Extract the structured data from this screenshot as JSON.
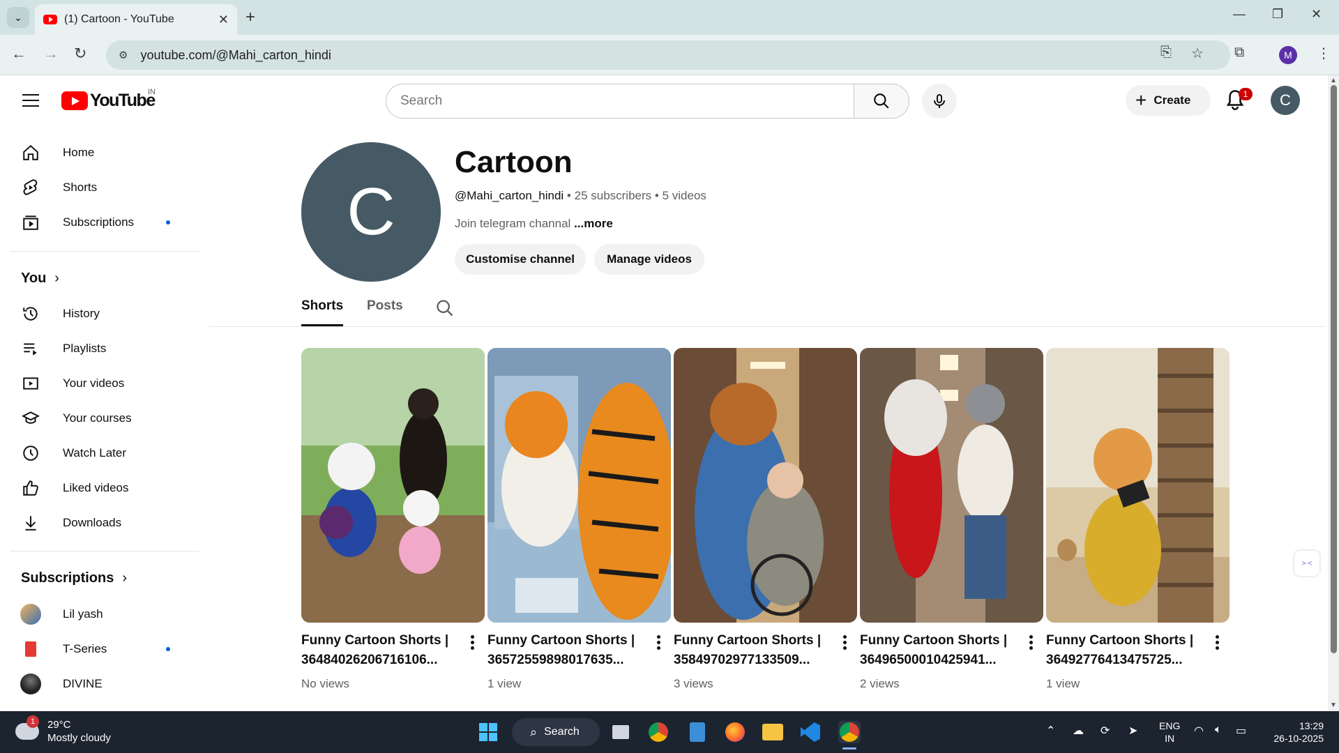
{
  "browser": {
    "tab_title": "(1) Cartoon - YouTube",
    "url": "youtube.com/@Mahi_carton_hindi",
    "profile_initial": "M"
  },
  "header": {
    "logo_text": "YouTube",
    "country": "IN",
    "search_placeholder": "Search",
    "create_label": "Create",
    "notification_count": "1",
    "avatar_initial": "C"
  },
  "sidebar": {
    "main": [
      {
        "label": "Home",
        "icon": "home-icon"
      },
      {
        "label": "Shorts",
        "icon": "shorts-icon"
      },
      {
        "label": "Subscriptions",
        "icon": "subscriptions-icon"
      }
    ],
    "you_title": "You",
    "you": [
      {
        "label": "History",
        "icon": "history-icon"
      },
      {
        "label": "Playlists",
        "icon": "playlists-icon"
      },
      {
        "label": "Your videos",
        "icon": "your-videos-icon"
      },
      {
        "label": "Your courses",
        "icon": "courses-icon"
      },
      {
        "label": "Watch Later",
        "icon": "clock-icon"
      },
      {
        "label": "Liked videos",
        "icon": "thumbs-up-icon"
      },
      {
        "label": "Downloads",
        "icon": "download-icon"
      }
    ],
    "subs_title": "Subscriptions",
    "subscriptions": [
      {
        "label": "Lil yash"
      },
      {
        "label": "T-Series"
      },
      {
        "label": "DIVINE"
      }
    ]
  },
  "channel": {
    "avatar_letter": "C",
    "name": "Cartoon",
    "handle": "@Mahi_carton_hindi",
    "subscribers": "25 subscribers",
    "videos": "5 videos",
    "separator": "•",
    "description": "Join telegram channal",
    "more": "...more",
    "customise_label": "Customise channel",
    "manage_label": "Manage videos",
    "tabs": [
      "Shorts",
      "Posts"
    ]
  },
  "shorts": [
    {
      "title1": "Funny Cartoon Shorts |",
      "title2": "36484026206716106...",
      "views": "No views"
    },
    {
      "title1": "Funny Cartoon Shorts |",
      "title2": "36572559898017635...",
      "views": "1 view"
    },
    {
      "title1": "Funny Cartoon Shorts |",
      "title2": "35849702977133509...",
      "views": "3 views"
    },
    {
      "title1": "Funny Cartoon Shorts |",
      "title2": "36496500010425941...",
      "views": "2 views"
    },
    {
      "title1": "Funny Cartoon Shorts |",
      "title2": "36492776413475725...",
      "views": "1 view"
    }
  ],
  "taskbar": {
    "weather_temp": "29°C",
    "weather_desc": "Mostly cloudy",
    "weather_badge": "1",
    "search_label": "Search",
    "lang_line1": "ENG",
    "lang_line2": "IN",
    "time": "13:29",
    "date": "26-10-2025"
  },
  "colors": {
    "youtube_red": "#ff0000",
    "channel_avatar": "#455a64",
    "subscription_dot": "#065fd4"
  }
}
